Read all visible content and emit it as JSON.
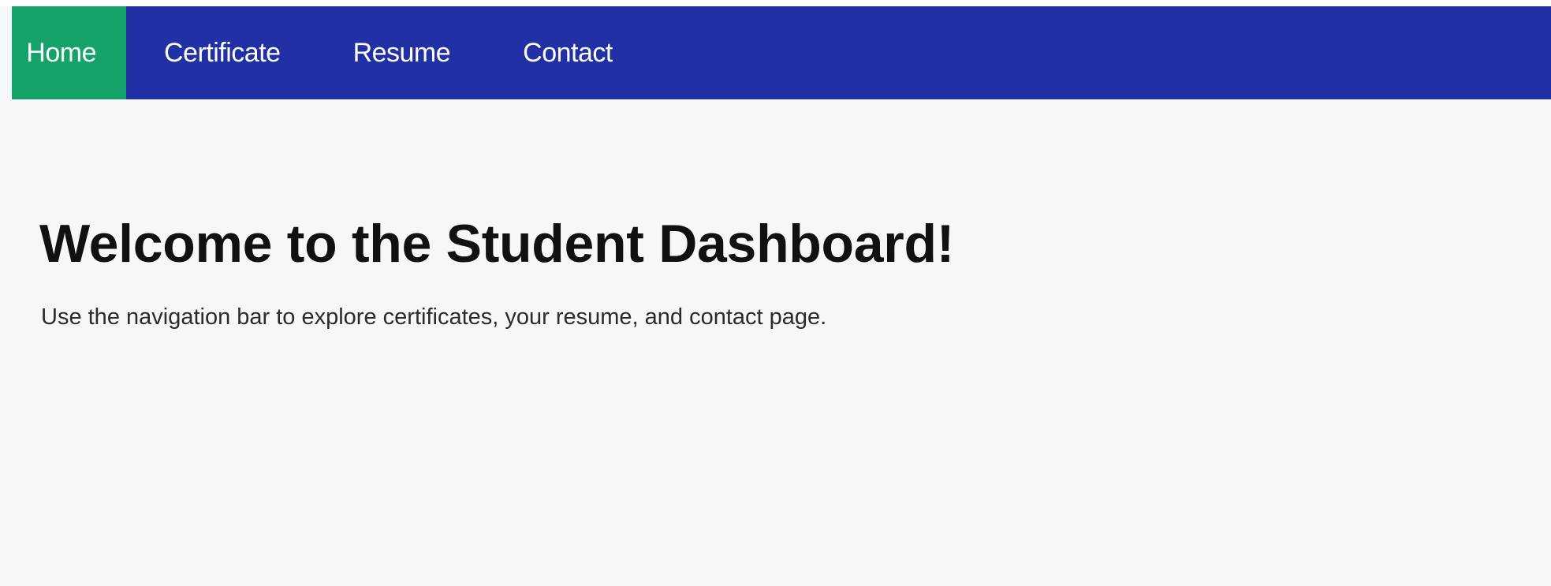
{
  "nav": {
    "items": [
      {
        "label": "Home",
        "active": true
      },
      {
        "label": "Certificate",
        "active": false
      },
      {
        "label": "Resume",
        "active": false
      },
      {
        "label": "Contact",
        "active": false
      }
    ]
  },
  "main": {
    "title": "Welcome to the Student Dashboard!",
    "description": "Use the navigation bar to explore certificates, your resume, and contact page."
  },
  "colors": {
    "navbar_bg": "#2230a6",
    "active_tab_bg": "#16a36a",
    "page_bg": "#f5f7f9"
  }
}
